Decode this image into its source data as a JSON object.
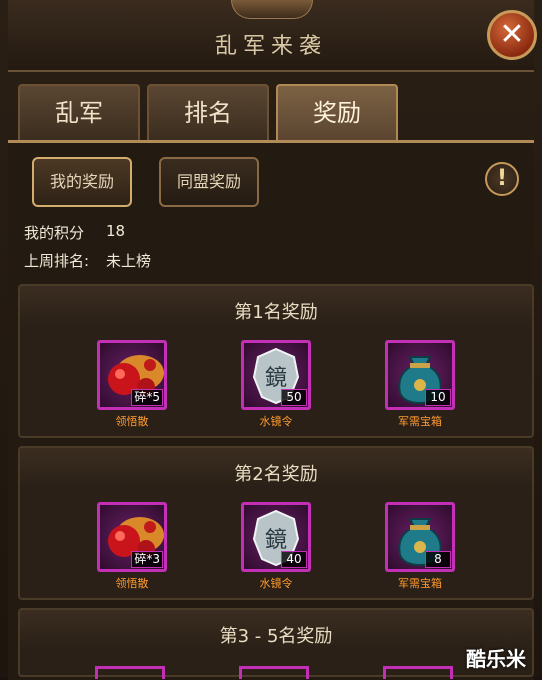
{
  "window": {
    "title": "乱军来袭"
  },
  "tabs": [
    {
      "label": "乱军",
      "active": false
    },
    {
      "label": "排名",
      "active": false
    },
    {
      "label": "奖励",
      "active": true
    }
  ],
  "subtabs": [
    {
      "label": "我的奖励",
      "active": true
    },
    {
      "label": "同盟奖励",
      "active": false
    }
  ],
  "stats": {
    "score_label": "我的积分",
    "score_value": "18",
    "rank_label": "上周排名:",
    "rank_value": "未上榜"
  },
  "sections": [
    {
      "title": "第1名奖励",
      "items": [
        {
          "name": "领悟散",
          "qty": "碎*5",
          "icon": "red-pills-icon"
        },
        {
          "name": "水镜令",
          "qty": "50",
          "icon": "mirror-token-icon"
        },
        {
          "name": "军需宝箱",
          "qty": "10",
          "icon": "treasure-bag-icon"
        }
      ]
    },
    {
      "title": "第2名奖励",
      "items": [
        {
          "name": "领悟散",
          "qty": "碎*3",
          "icon": "red-pills-icon"
        },
        {
          "name": "水镜令",
          "qty": "40",
          "icon": "mirror-token-icon"
        },
        {
          "name": "军需宝箱",
          "qty": "8",
          "icon": "treasure-bag-icon"
        }
      ]
    },
    {
      "title": "第3 - 5名奖励",
      "items": []
    }
  ],
  "mirror_glyph": "鏡",
  "watermark": "酷乐米",
  "colors": {
    "item_border": "#c32fb6",
    "item_name": "#ff9a2e",
    "accent_gold": "#c79a5a"
  }
}
